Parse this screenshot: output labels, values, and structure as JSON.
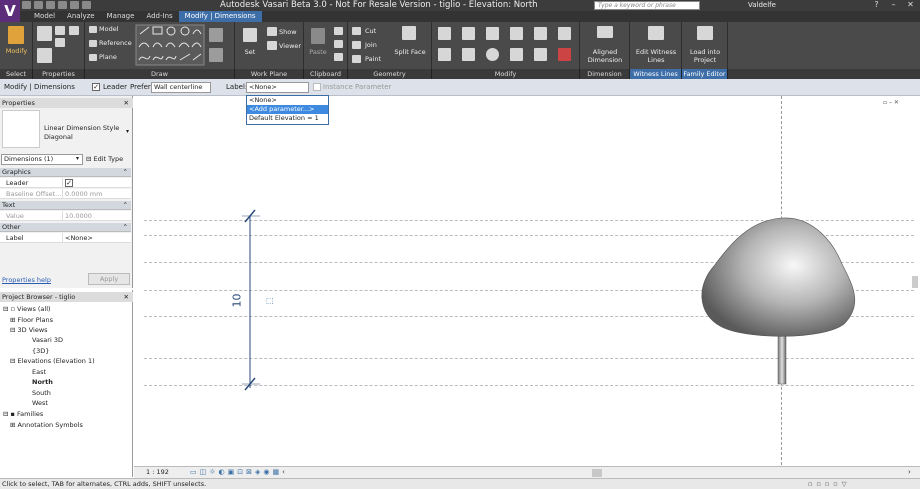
{
  "app": {
    "title": "Autodesk Vasari Beta 3.0 - Not For Resale Version -     tiglio - Elevation: North",
    "search_placeholder": "Type a keyword or phrase",
    "user": "Valdelfe"
  },
  "tabs": [
    "Model",
    "Analyze",
    "Manage",
    "Add-Ins",
    "Modify | Dimensions"
  ],
  "ribbon": {
    "modify": "Modify",
    "model": "Model",
    "reference": "Reference",
    "plane": "Plane",
    "set": "Set",
    "show": "Show",
    "viewer": "Viewer",
    "paste": "Paste",
    "cut": "Cut",
    "join": "Join",
    "paint": "Paint",
    "split_face": "Split Face",
    "aligned_dimension": "Aligned Dimension",
    "edit_witness_lines": "Edit Witness Lines",
    "load_into_project": "Load into Project"
  },
  "group_labels": {
    "select": "Select",
    "properties": "Properties",
    "draw": "Draw",
    "work_plane": "Work Plane",
    "clipboard": "Clipboard",
    "geometry": "Geometry",
    "modify": "Modify",
    "dimension": "Dimension",
    "witness_lines": "Witness Lines",
    "family_editor": "Family Editor"
  },
  "options_bar": {
    "context": "Modify | Dimensions",
    "leader_label": "Leader",
    "prefer_label": "Prefer:",
    "prefer_value": "Wall centerline",
    "label_label": "Label:",
    "label_value": "<None>",
    "instance_param": "Instance Parameter"
  },
  "dropdown": [
    "<None>",
    "<Add parameter...>",
    "Default Elevation = 1"
  ],
  "properties": {
    "header": "Properties",
    "type_name": "Linear Dimension Style",
    "type_sub": "Diagonal",
    "selector": "Dimensions (1)",
    "edit_type": "Edit Type",
    "cat_graphics": "Graphics",
    "leader": "Leader",
    "baseline_offset": "Baseline Offset...",
    "baseline_offset_value": "0.0000 mm",
    "cat_text": "Text",
    "value": "Value",
    "value_value": "10.0000",
    "cat_other": "Other",
    "label": "Label",
    "label_value": "<None>",
    "help": "Properties help",
    "apply": "Apply"
  },
  "project_browser": {
    "header": "Project Browser - tiglio",
    "views_all": "Views (all)",
    "floor_plans": "Floor Plans",
    "views_3d": "3D Views",
    "vasari_3d": "Vasari 3D",
    "view_3d": "{3D}",
    "elevations": "Elevations (Elevation 1)",
    "east": "East",
    "north": "North",
    "south": "South",
    "west": "West",
    "families": "Families",
    "annotation_symbols": "Annotation Symbols"
  },
  "canvas": {
    "dimension_text": "10"
  },
  "view_control": {
    "scale": "1 : 192"
  },
  "status": {
    "text": "Click to select, TAB for alternates, CTRL adds, SHIFT unselects."
  }
}
